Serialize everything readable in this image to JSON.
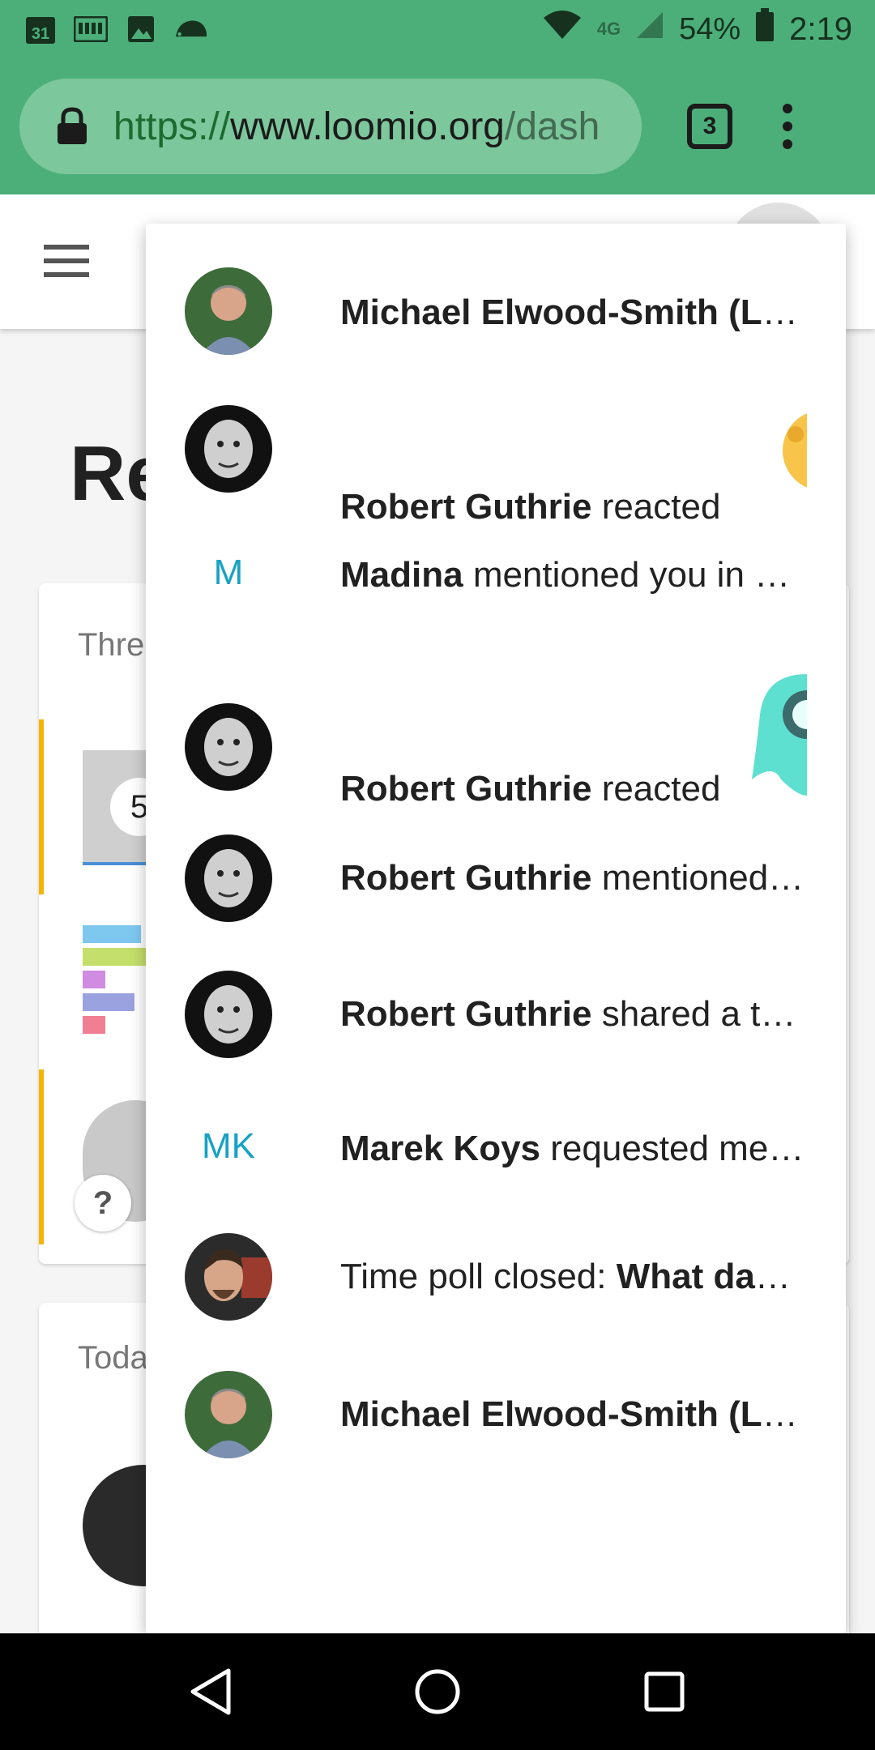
{
  "status_bar": {
    "time": "2:19",
    "battery": "54%",
    "network": "4G",
    "icons": [
      "calendar-icon",
      "keyboard-icon",
      "image-icon",
      "hedgehog-icon",
      "wifi-icon",
      "signal-icon",
      "battery-icon"
    ],
    "calendar_day": "31"
  },
  "browser": {
    "url_scheme": "https://",
    "url_host": "www.loomio.org",
    "url_path": "/dash",
    "tab_count": "3"
  },
  "page": {
    "heading": "Re",
    "card1_label": "Thre",
    "card1_badge": "5",
    "card1_question": "?",
    "card2_label": "Toda"
  },
  "notifications": [
    {
      "avatar": "photo-michael",
      "actor": "Michael Elwood-Smith (Loomio)",
      "text": "",
      "truncated": true
    },
    {
      "avatar": "photo-robert",
      "actor": "Robert Guthrie",
      "text": "reacted",
      "emoji": "yellow-emoji"
    },
    {
      "initials": "M",
      "actor": "Madina",
      "text": "mentioned you in a comment",
      "truncated": true
    },
    {
      "avatar": "photo-robert",
      "actor": "Robert Guthrie",
      "text": "reacted",
      "emoji": "teal-emoji"
    },
    {
      "avatar": "photo-robert",
      "actor": "Robert Guthrie",
      "text": "mentioned you",
      "truncated": true
    },
    {
      "avatar": "photo-robert",
      "actor": "Robert Guthrie",
      "text": "shared a thread",
      "truncated": true
    },
    {
      "initials": "MK",
      "actor": "Marek Koys",
      "text": "requested membership",
      "truncated": true
    },
    {
      "avatar": "photo-young-man",
      "prefix": "Time poll closed: ",
      "title": "What day works best?",
      "truncated": true
    },
    {
      "avatar": "photo-michael",
      "actor": "Michael Elwood-Smith (Loomio)",
      "text": "",
      "truncated": true
    }
  ],
  "colors": {
    "brand_green": "#4caf7a",
    "url_pill": "#7cc79c",
    "initials_teal": "#17a2c4",
    "accent_yellow": "#f5b400"
  },
  "nav": {
    "back": "back-icon",
    "home": "home-icon",
    "recents": "recents-icon"
  }
}
